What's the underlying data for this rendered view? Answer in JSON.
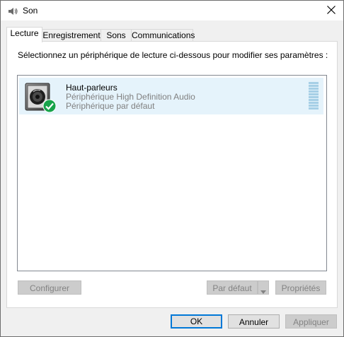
{
  "window": {
    "title": "Son",
    "icons": {
      "app": "speaker-icon",
      "close": "close-icon"
    }
  },
  "tabs": [
    {
      "label": "Lecture",
      "active": true
    },
    {
      "label": "Enregistrement",
      "active": false
    },
    {
      "label": "Sons",
      "active": false
    },
    {
      "label": "Communications",
      "active": false
    }
  ],
  "panel": {
    "instructions": "Sélectionnez un périphérique de lecture ci-dessous pour modifier ses paramètres :",
    "devices": [
      {
        "name": "Haut-parleurs",
        "description": "Périphérique High Definition Audio",
        "status": "Périphérique par défaut",
        "selected": true,
        "icon": "speaker-device-icon",
        "badge": "default-check-icon"
      }
    ],
    "buttons": {
      "configure": "Configurer",
      "set_default": "Par défaut",
      "properties": "Propriétés"
    }
  },
  "footer": {
    "ok": "OK",
    "cancel": "Annuler",
    "apply": "Appliquer"
  },
  "colors": {
    "accent": "#0078d7",
    "selection": "#e5f3fb",
    "check_badge": "#17a34a"
  }
}
